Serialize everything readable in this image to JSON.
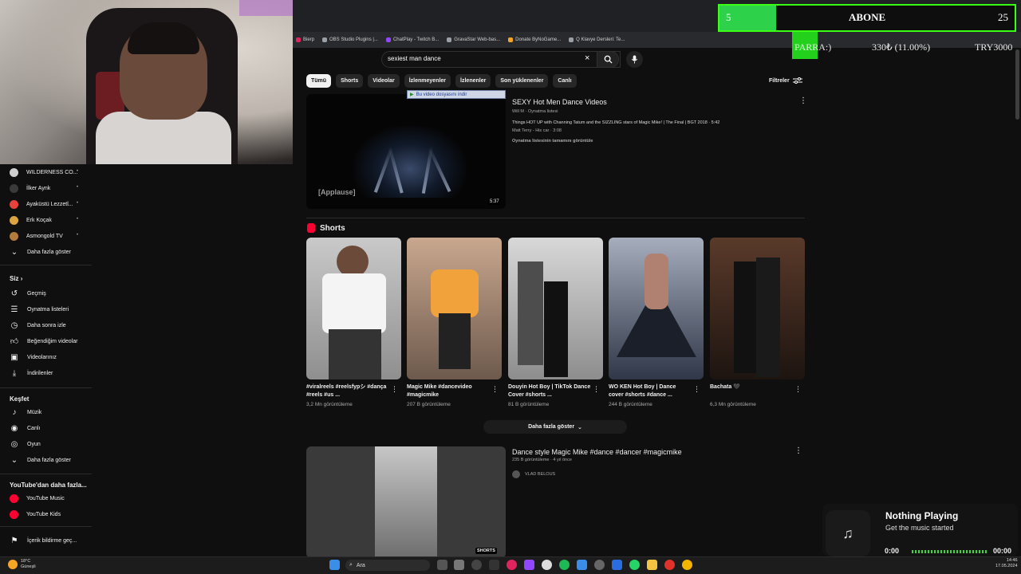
{
  "overlay": {
    "abone_count": "5",
    "abone_title": "ABONE",
    "abone_goal": "25",
    "abone_progress": 0.2,
    "para_label": "PARRA:)",
    "para_amount": "330₺ (11.00%)",
    "para_goal": "TRY3000"
  },
  "bookmarks": [
    "Bierp",
    "OBS Studio Plugins |...",
    "ChatPlay - Twitch B...",
    "GravaStar Web-bas...",
    "Donate ByNoGame...",
    "Q Klavye Dersleri: Te..."
  ],
  "search": {
    "query": "sexiest man dance",
    "clear_icon": "×"
  },
  "chips": [
    "Tümü",
    "Shorts",
    "Videolar",
    "İzlenmeyenler",
    "İzlenenler",
    "Son yüklenenler",
    "Canlı"
  ],
  "filters_label": "Filtreler",
  "download_bar": "Bu video dosyasını indir",
  "result1": {
    "title": "SEXY Hot Men Dance Videos",
    "meta": "Will M · Oynatma listesi",
    "line1": "Things HOT UP with Channing Tatum and the SIZZLING stars of Magic Mike! | The Final | BGT 2018 · 5:42",
    "line2": "Matt Terry - His car · 3:08",
    "view_all": "Oynatma listesinin tamamını görüntüle",
    "caption": "[Applause]",
    "duration": "5:37"
  },
  "shorts_section": {
    "label": "Shorts",
    "items": [
      {
        "title": "#viralreels #reelsfypシ #dança #reels #us ...",
        "views": "3,2 Mn görüntüleme"
      },
      {
        "title": "Magic Mike #dancevideo #magicmike",
        "views": "207 B görüntüleme"
      },
      {
        "title": "Douyin Hot Boy | TikTok Dance Cover #shorts ...",
        "views": "81 B görüntüleme"
      },
      {
        "title": "WO KEN Hot Boy | Dance cover #shorts #dance ...",
        "views": "244 B görüntüleme"
      },
      {
        "title": "Bachata 🖤",
        "views": "6,3 Mn görüntüleme"
      }
    ],
    "more_label": "Daha fazla göster"
  },
  "result2": {
    "title": "Dance style Magic Mike #dance #dancer #magicmike",
    "meta": "235 B görüntüleme · 4 yıl önce",
    "channel": "VLAD BELOUS",
    "badge": "SHORTS"
  },
  "sidebar": {
    "subscriptions": [
      {
        "label": "WILDERNESS CO...",
        "color": "#cfcfcf"
      },
      {
        "label": "İlker Aynk",
        "color": "#3a3a3a"
      },
      {
        "label": "Ayaküstü Lezzetl...",
        "color": "#e5433b"
      },
      {
        "label": "Erk Koçak",
        "color": "#d9a441"
      },
      {
        "label": "Asmongold TV",
        "color": "#b47a3c"
      }
    ],
    "show_more": "Daha fazla göster",
    "you_head": "Siz",
    "you_items": [
      "Geçmiş",
      "Oynatma listeleri",
      "Daha sonra izle",
      "Beğendiğim videolar",
      "Videolarınız",
      "İndirilenler"
    ],
    "explore_head": "Keşfet",
    "explore_items": [
      "Müzik",
      "Canlı",
      "Oyun"
    ],
    "explore_more": "Daha fazla göster",
    "more_yt_head": "YouTube'dan daha fazla...",
    "more_yt_items": [
      "YouTube Music",
      "YouTube Kids"
    ],
    "report": "İçerik bildirme geç..."
  },
  "music": {
    "title": "Nothing Playing",
    "subtitle": "Get the music started",
    "start": "0:00",
    "end": "00:00"
  },
  "taskbar": {
    "weather_temp": "18°C",
    "weather_desc": "Güneşli",
    "search_label": "Ara",
    "time": "14:46",
    "date": "17.05.2024"
  },
  "colors": {
    "bg": "#0f0f0f",
    "accent_green": "#2ed14a",
    "youtube_red": "#ff0033"
  }
}
